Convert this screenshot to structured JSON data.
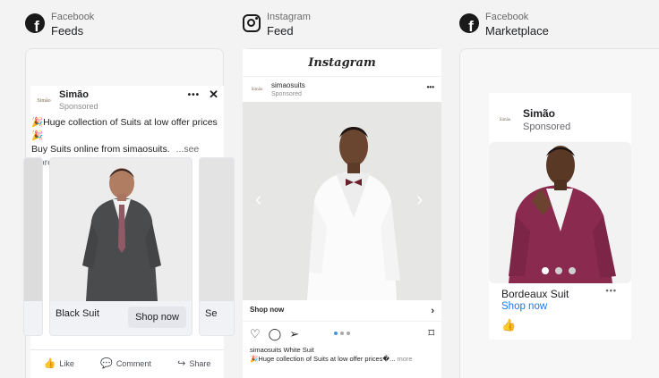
{
  "placements": [
    {
      "platform": "Facebook",
      "format": "Feeds"
    },
    {
      "platform": "Instagram",
      "format": "Feed"
    },
    {
      "platform": "Facebook",
      "format": "Marketplace"
    }
  ],
  "brand": {
    "logo_text": "Simão"
  },
  "fb_feed": {
    "name": "Simão",
    "sponsored": "Sponsored",
    "more_icon": "•••",
    "close_icon": "✕",
    "text_line1": "🎉Huge collection of Suits at low offer prices 🎉",
    "text_line2": "Buy Suits online from simaosuits.",
    "see_more": "...see more",
    "card_title": "Black Suit",
    "cta": "Shop now",
    "next_card_cta_partial": "Se",
    "actions": {
      "like": "Like",
      "comment": "Comment",
      "share": "Share"
    }
  },
  "ig_feed": {
    "wordmark": "Instagram",
    "username": "simaosuits",
    "sponsored": "Sponsored",
    "more_icon": "•••",
    "shop_now": "Shop now",
    "caption_line1": "simaosuits White Suit",
    "caption_line2": "🎉Huge collection of Suits at low offer prices�...",
    "caption_more": "more"
  },
  "marketplace": {
    "name": "Simão",
    "sponsored": "Sponsored",
    "title": "Bordeaux Suit",
    "shop_now": "Shop now",
    "more_icon": "•••"
  },
  "colors": {
    "link_blue": "#1877f2",
    "bordeaux": "#8a2a4e",
    "ig_dot_active": "#3897f0"
  }
}
